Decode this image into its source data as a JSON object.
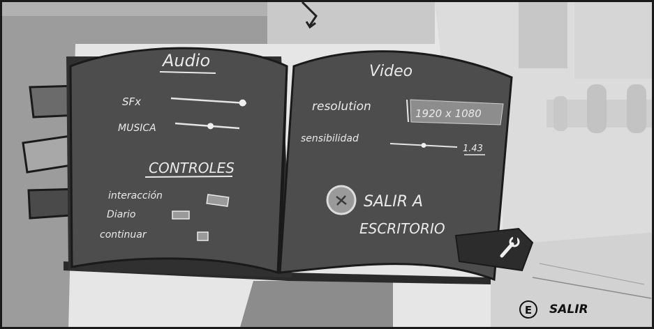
{
  "menu": {
    "audio": {
      "heading": "Audio",
      "sfx": {
        "label": "SFx",
        "level": 0.95
      },
      "musica": {
        "label": "MUSICA",
        "level": 0.55
      }
    },
    "controles": {
      "heading": "CONTROLES",
      "items": [
        {
          "label": "interacción"
        },
        {
          "label": "Diario"
        },
        {
          "label": "continuar"
        }
      ]
    },
    "video": {
      "heading": "Video",
      "resolution": {
        "label": "resolution",
        "value": "1920 x 1080"
      },
      "sensibilidad": {
        "label": "sensibilidad",
        "value": "1.43",
        "level": 0.5
      }
    },
    "exit_desktop": {
      "label_line1": "SALIR A",
      "label_line2": "ESCRITORIO",
      "icon": "close-icon"
    },
    "settings_tab": {
      "icon": "wrench-icon"
    }
  },
  "prompt": {
    "key": "E",
    "label": "SALIR"
  },
  "colors": {
    "page": "#4d4d4d",
    "cover": "#353535",
    "ink": "#eaeaea",
    "background": "#e9e9e9"
  }
}
